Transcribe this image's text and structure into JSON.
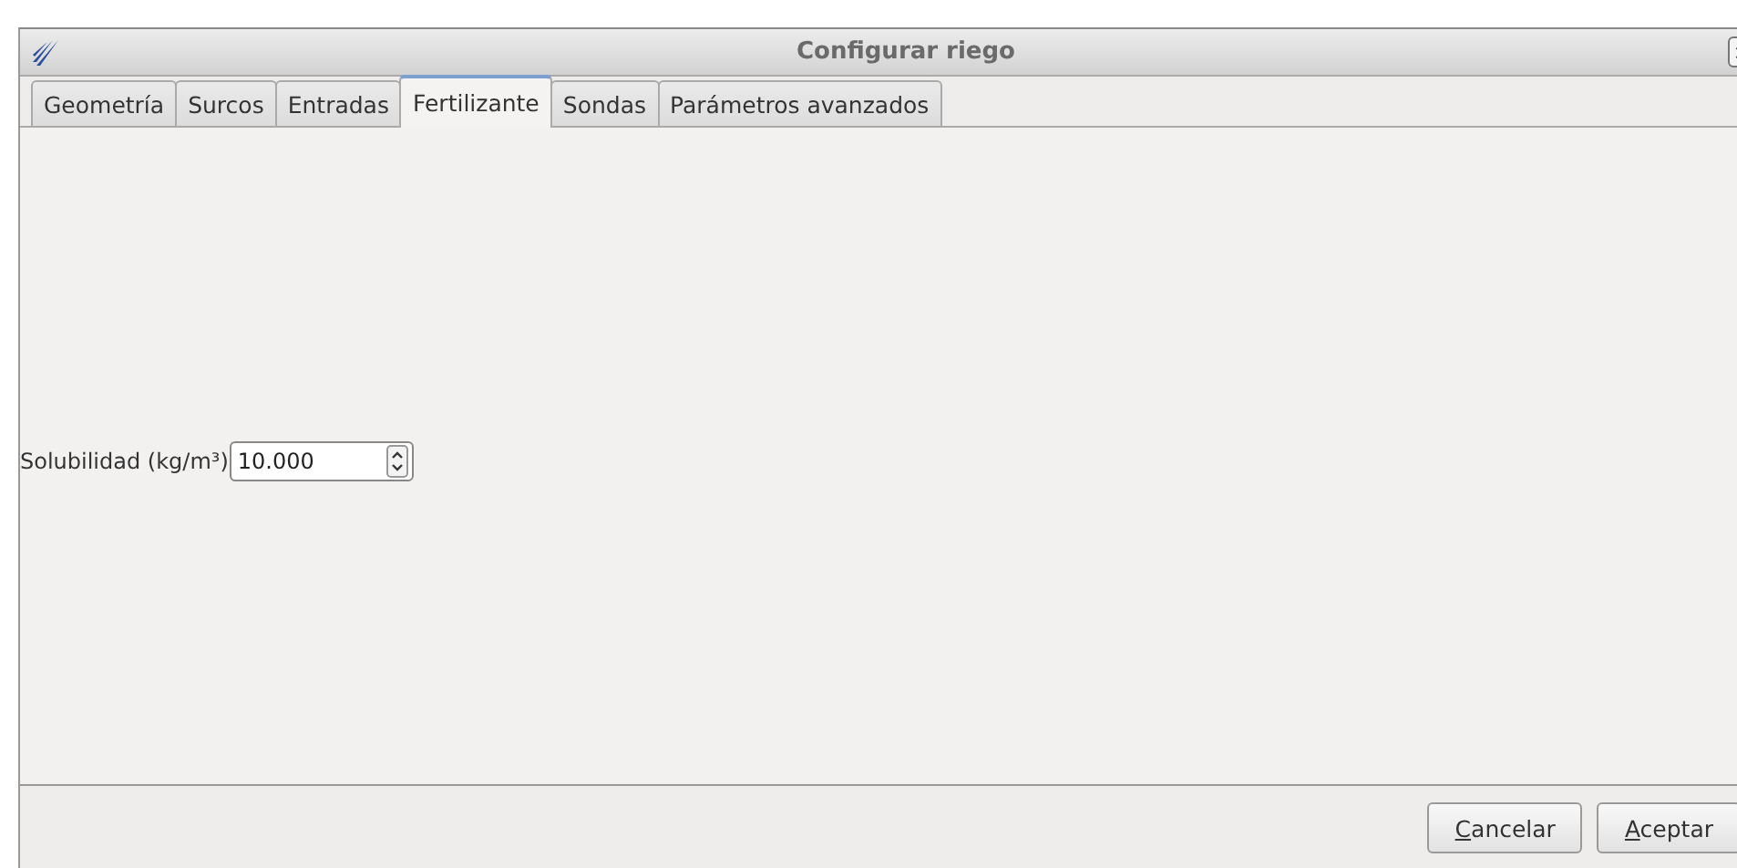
{
  "window": {
    "title": "Configurar riego"
  },
  "tabs": [
    {
      "label": "Geometría",
      "selected": false
    },
    {
      "label": "Surcos",
      "selected": false
    },
    {
      "label": "Entradas",
      "selected": false
    },
    {
      "label": "Fertilizante",
      "selected": true
    },
    {
      "label": "Sondas",
      "selected": false
    },
    {
      "label": "Parámetros avanzados",
      "selected": false
    }
  ],
  "fields": [
    {
      "label": "Solubilidad (kg/m³)",
      "value": "10.000"
    }
  ],
  "buttons": [
    "Cancelar",
    "Aceptar"
  ]
}
